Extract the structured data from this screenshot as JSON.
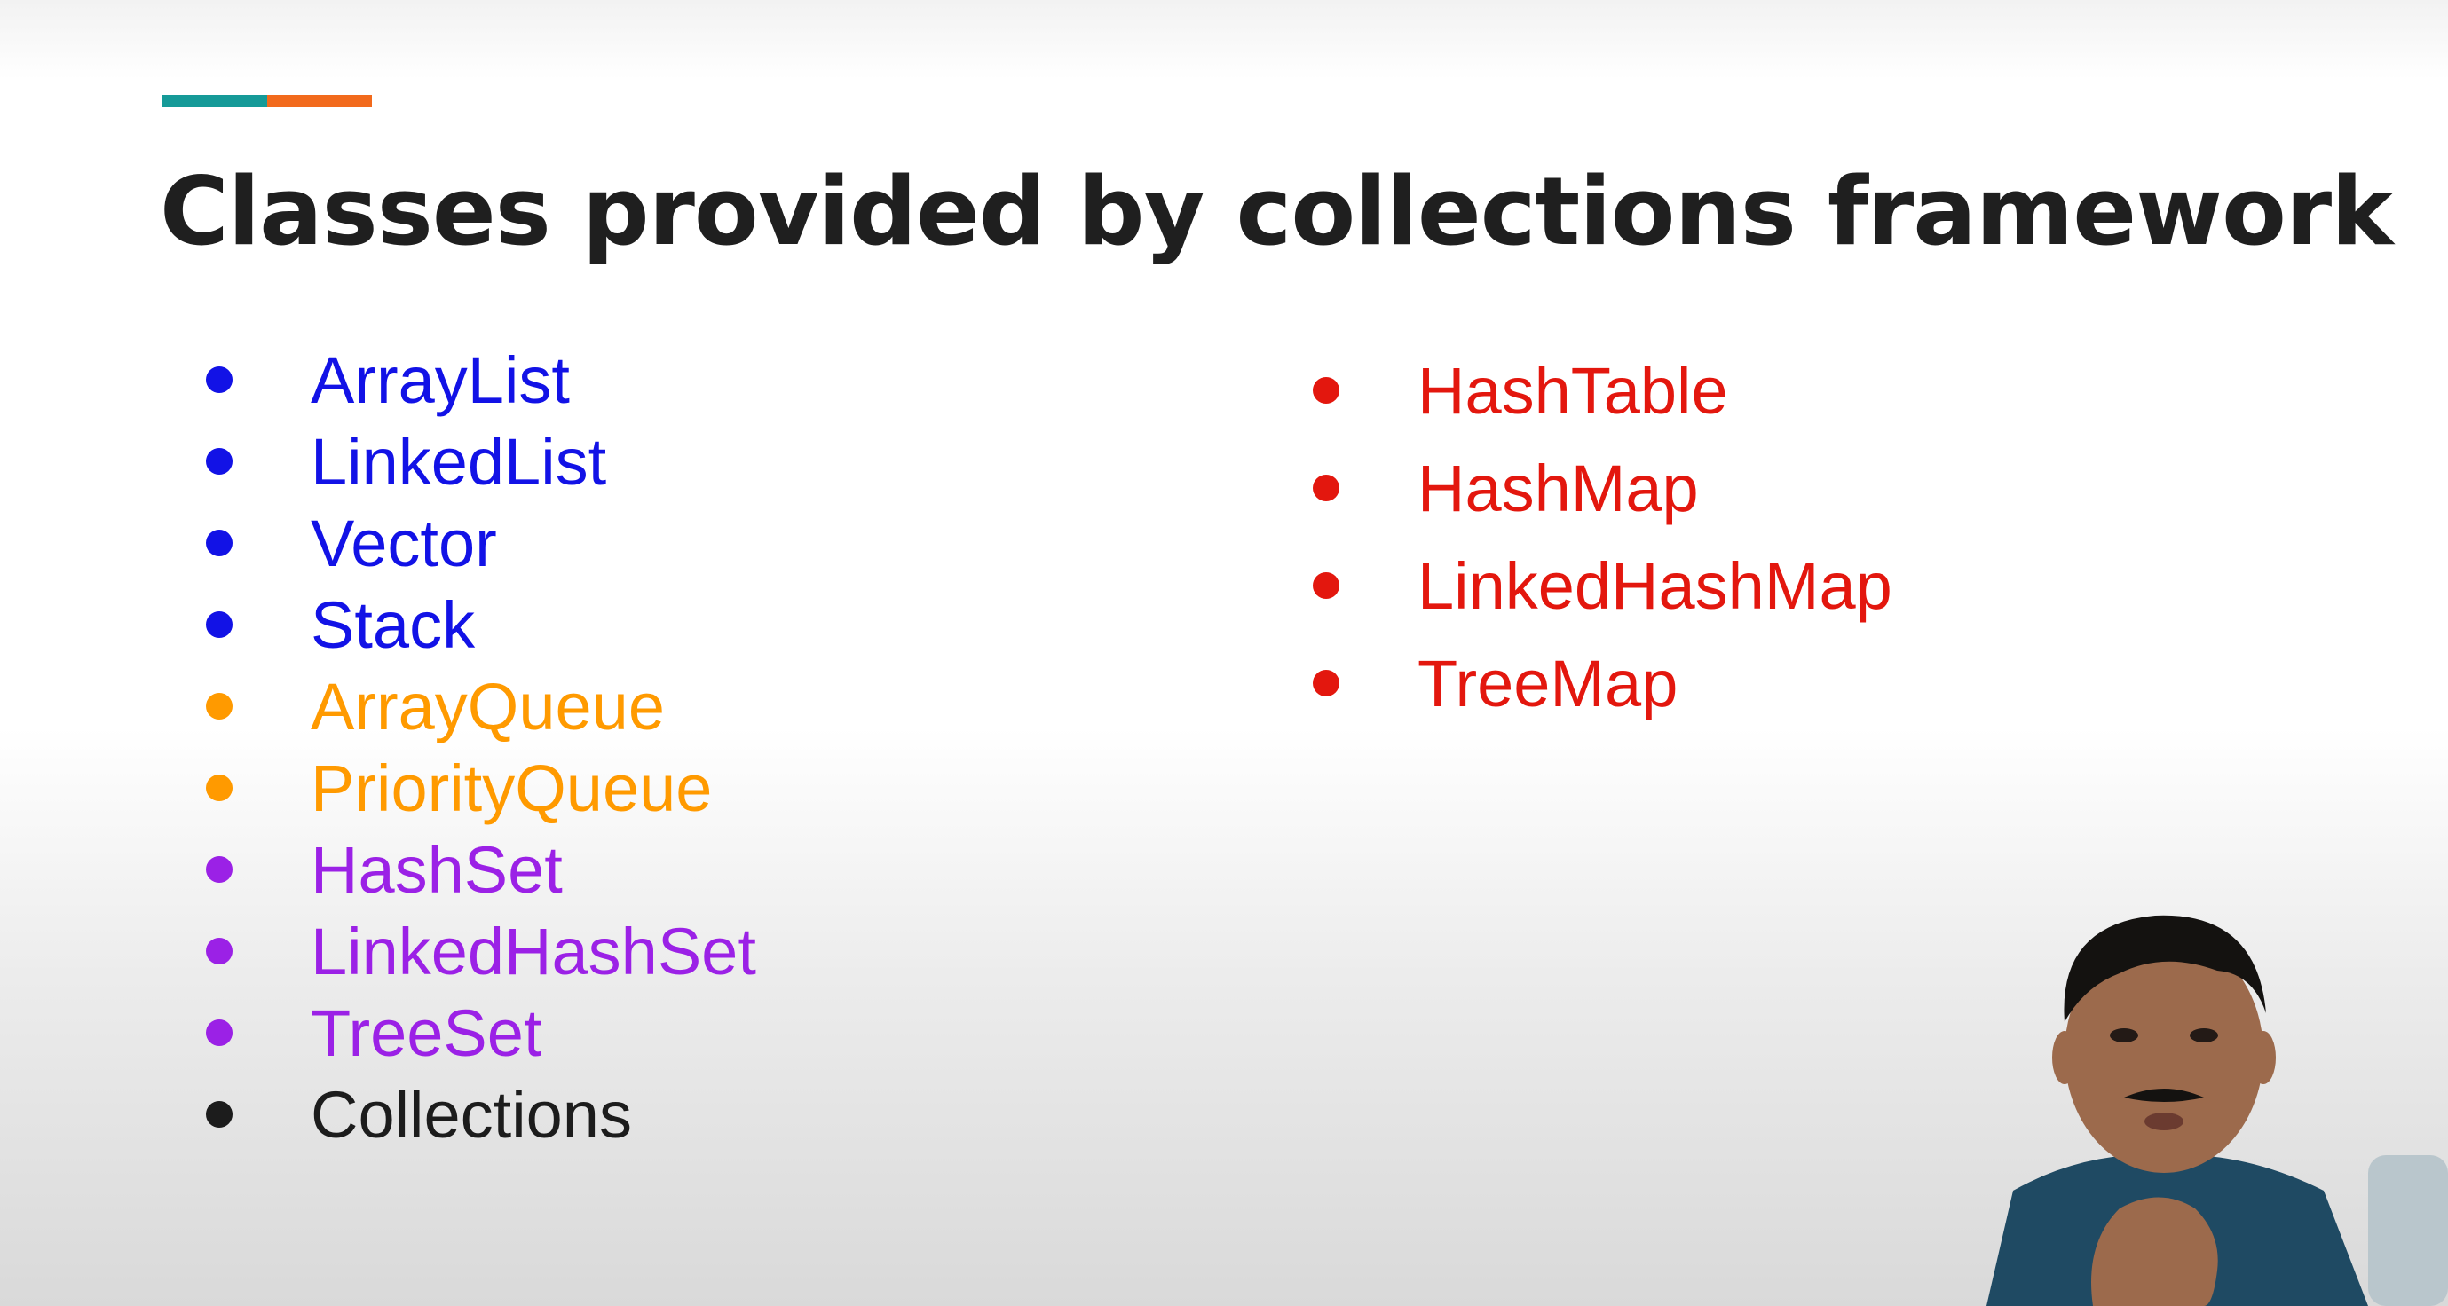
{
  "slide": {
    "title": "Classes provided by collections framework",
    "accent_colors": [
      "#159a98",
      "#f26a1c"
    ]
  },
  "left_list": [
    {
      "label": "ArrayList",
      "color": "#1212e6"
    },
    {
      "label": "LinkedList",
      "color": "#1212e6"
    },
    {
      "label": "Vector",
      "color": "#1212e6"
    },
    {
      "label": "Stack",
      "color": "#1212e6"
    },
    {
      "label": "ArrayQueue",
      "color": "#ff9a00"
    },
    {
      "label": "PriorityQueue",
      "color": "#ff9a00"
    },
    {
      "label": "HashSet",
      "color": "#9b21e6"
    },
    {
      "label": "LinkedHashSet",
      "color": "#9b21e6"
    },
    {
      "label": "TreeSet",
      "color": "#9b21e6"
    },
    {
      "label": "Collections",
      "color": "#1c1c1c"
    }
  ],
  "right_list": [
    {
      "label": "HashTable",
      "color": "#e3170e"
    },
    {
      "label": "HashMap",
      "color": "#e3170e"
    },
    {
      "label": "LinkedHashMap",
      "color": "#e3170e"
    },
    {
      "label": "TreeMap",
      "color": "#e3170e"
    }
  ],
  "presenter": {
    "shirt_color": "#1f4a63",
    "hair_color": "#141210",
    "skin_color": "#9c6a4c"
  }
}
